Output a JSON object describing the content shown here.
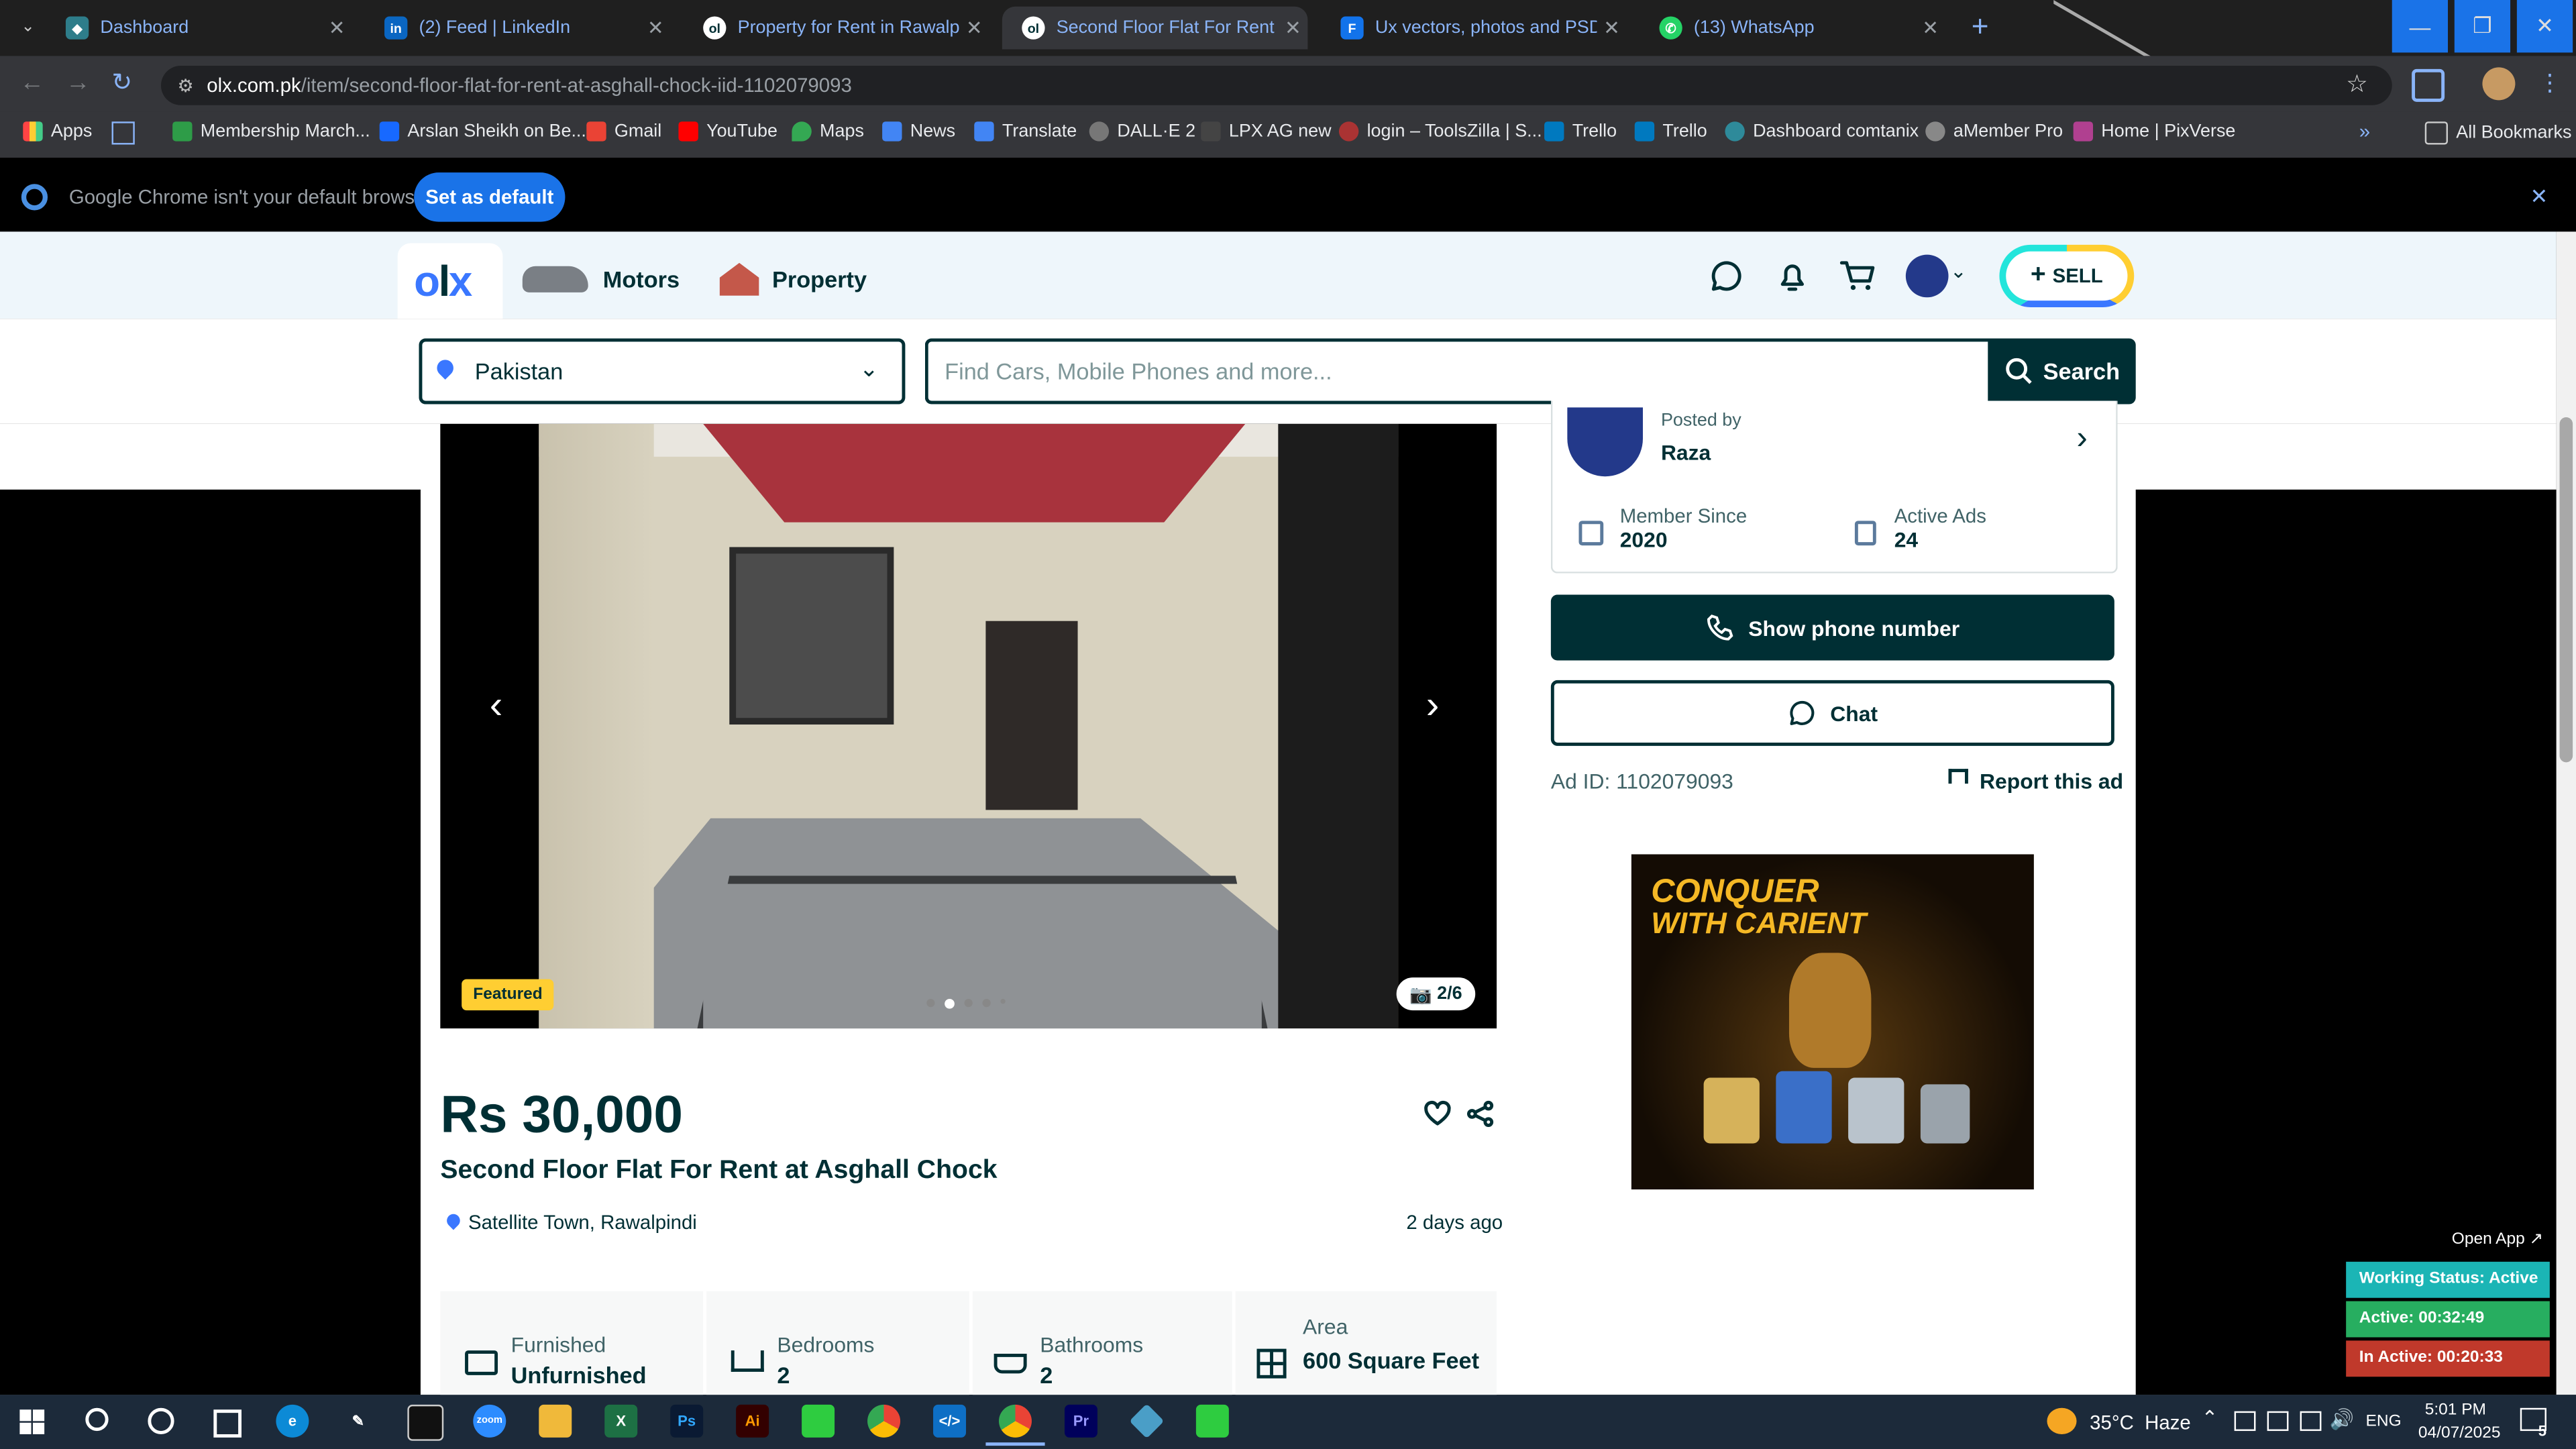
{
  "tabs": [
    {
      "title": "Dashboard"
    },
    {
      "title": "(2) Feed | LinkedIn"
    },
    {
      "title": "Property for Rent in Rawalpindi"
    },
    {
      "title": "Second Floor Flat For Rent at A"
    },
    {
      "title": "Ux vectors, photos and PSD file"
    },
    {
      "title": "(13) WhatsApp"
    }
  ],
  "address": {
    "domain": "olx.com.pk",
    "path": "/item/second-floor-flat-for-rent-at-asghall-chock-iid-1102079093"
  },
  "bookmarks": [
    "Apps",
    "Membership March...",
    "Arslan Sheikh on Be...",
    "Gmail",
    "YouTube",
    "Maps",
    "News",
    "Translate",
    "DALL·E 2",
    "LPX AG new",
    "login – ToolsZilla | S...",
    "Trello",
    "Trello",
    "Dashboard comtanix",
    "aMember Pro",
    "Home | PixVerse"
  ],
  "all_bookmarks": "All Bookmarks",
  "infobar": {
    "message": "Google Chrome isn't your default browser",
    "button": "Set as default"
  },
  "olx": {
    "nav": {
      "motors": "Motors",
      "property": "Property",
      "sell": "SELL"
    },
    "location": "Pakistan",
    "search_placeholder": "Find Cars, Mobile Phones and more...",
    "search_button": "Search"
  },
  "listing": {
    "badge": "Featured",
    "photo_counter": "2/6",
    "price": "Rs 30,000",
    "title": "Second Floor Flat For Rent at Asghall Chock",
    "location": "Satellite Town, Rawalpindi",
    "posted": "2 days ago",
    "attributes": [
      {
        "label": "Furnished",
        "value": "Unfurnished"
      },
      {
        "label": "Bedrooms",
        "value": "2"
      },
      {
        "label": "Bathrooms",
        "value": "2"
      },
      {
        "label": "Area",
        "value": "600 Square Feet"
      }
    ]
  },
  "seller": {
    "posted_by": "Posted by",
    "name": "Raza",
    "member_since_label": "Member Since",
    "member_since": "2020",
    "active_ads_label": "Active Ads",
    "active_ads": "24",
    "show_phone": "Show phone number",
    "chat": "Chat",
    "ad_id": "Ad ID: 1102079093",
    "report": "Report this ad"
  },
  "ad_banner": {
    "line1": "CONQUER",
    "line2": "WITH CARIENT"
  },
  "status_widget": {
    "open_app": "Open App ↗",
    "working": "Working Status: Active",
    "active": "Active: 00:32:49",
    "inactive": "In Active: 00:20:33"
  },
  "taskbar": {
    "weather": "35°C  Haze",
    "lang": "ENG",
    "time": "5:01 PM",
    "date": "04/07/2025",
    "notifications": "5"
  }
}
